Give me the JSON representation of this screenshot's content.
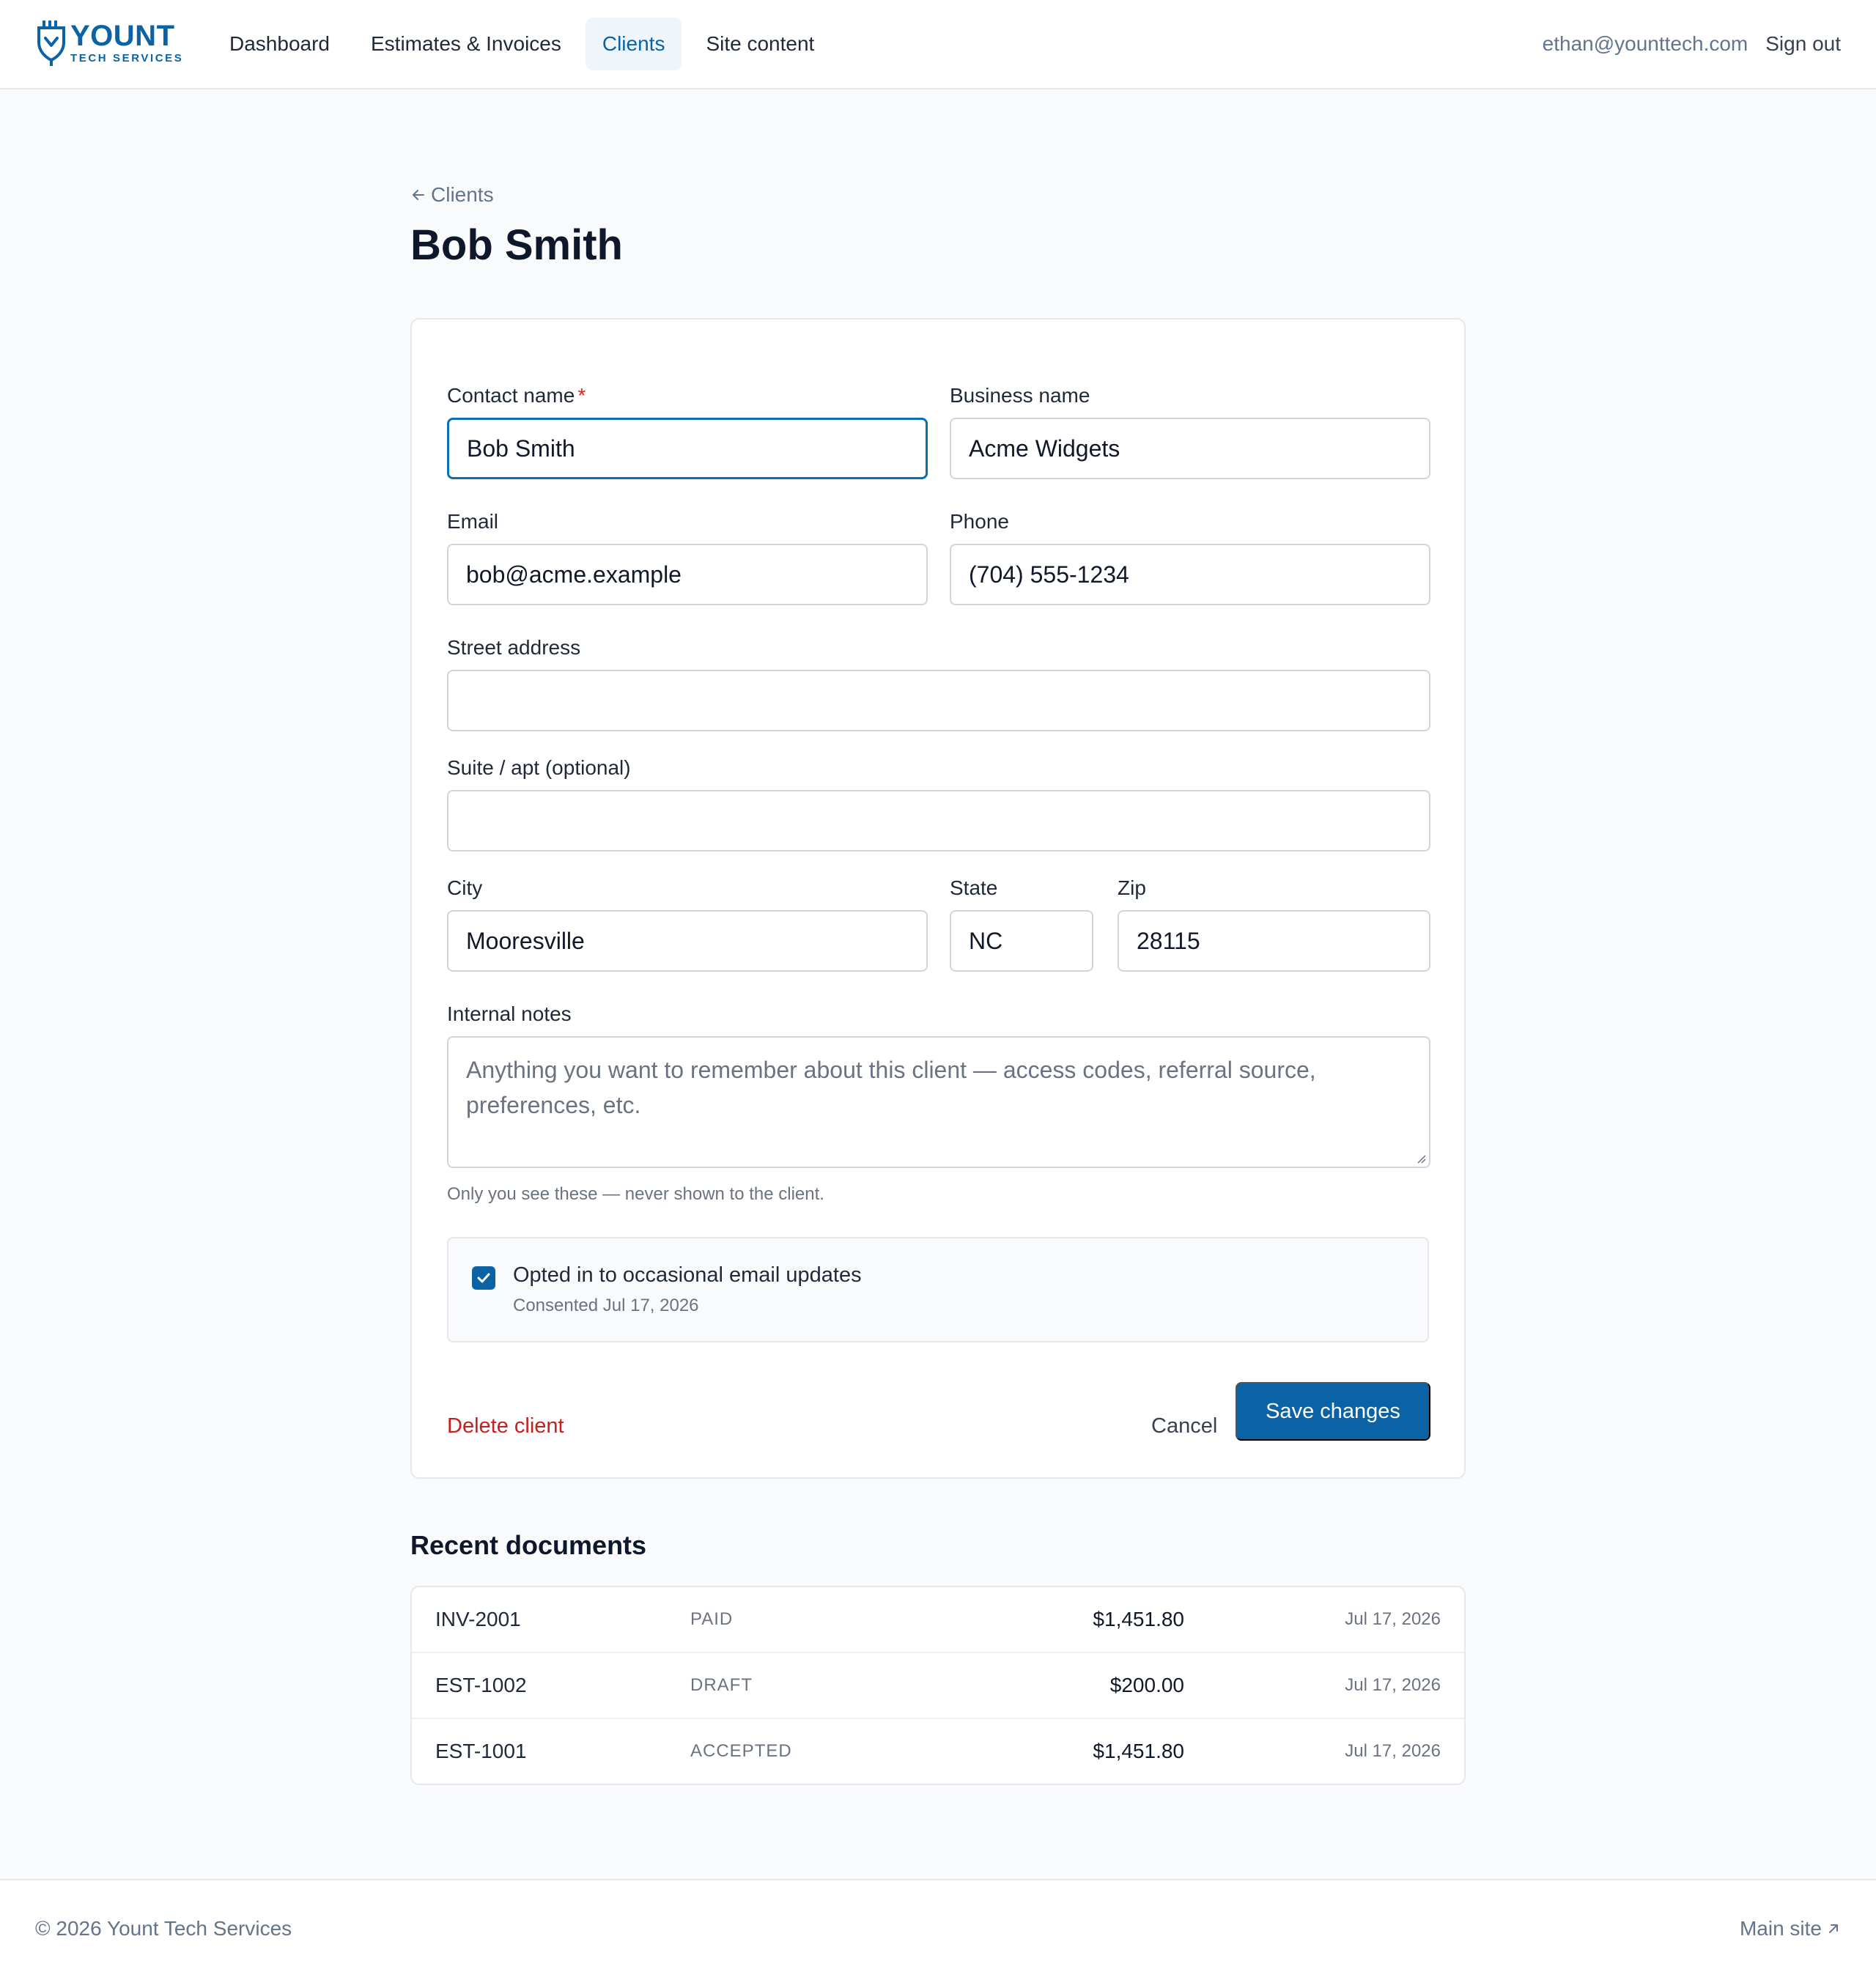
{
  "brand": {
    "name": "YOUNT",
    "tagline": "TECH SERVICES",
    "color": "#0b63a6"
  },
  "nav": {
    "items": [
      {
        "label": "Dashboard",
        "active": false
      },
      {
        "label": "Estimates & Invoices",
        "active": false
      },
      {
        "label": "Clients",
        "active": true
      },
      {
        "label": "Site content",
        "active": false
      }
    ]
  },
  "user": {
    "email": "ethan@younttech.com",
    "sign_out": "Sign out"
  },
  "breadcrumb": {
    "back_label": "Clients"
  },
  "page": {
    "title": "Bob Smith"
  },
  "form": {
    "contact_name": {
      "label": "Contact name",
      "required_mark": "*",
      "value": "Bob Smith"
    },
    "business_name": {
      "label": "Business name",
      "value": "Acme Widgets"
    },
    "email": {
      "label": "Email",
      "value": "bob@acme.example"
    },
    "phone": {
      "label": "Phone",
      "value": "(704) 555-1234"
    },
    "street": {
      "label": "Street address",
      "value": ""
    },
    "suite": {
      "label": "Suite / apt (optional)",
      "value": ""
    },
    "city": {
      "label": "City",
      "value": "Mooresville"
    },
    "state": {
      "label": "State",
      "value": "NC"
    },
    "zip": {
      "label": "Zip",
      "value": "28115"
    },
    "notes": {
      "label": "Internal notes",
      "placeholder": "Anything you want to remember about this client — access codes, referral source, preferences, etc.",
      "help": "Only you see these — never shown to the client."
    },
    "consent": {
      "checked": true,
      "label": "Opted in to occasional email updates",
      "sub": "Consented Jul 17, 2026"
    },
    "actions": {
      "delete": "Delete client",
      "cancel": "Cancel",
      "save": "Save changes"
    }
  },
  "documents": {
    "title": "Recent documents",
    "rows": [
      {
        "id": "INV-2001",
        "status": "PAID",
        "amount": "$1,451.80",
        "date": "Jul 17, 2026"
      },
      {
        "id": "EST-1002",
        "status": "DRAFT",
        "amount": "$200.00",
        "date": "Jul 17, 2026"
      },
      {
        "id": "EST-1001",
        "status": "ACCEPTED",
        "amount": "$1,451.80",
        "date": "Jul 17, 2026"
      }
    ]
  },
  "footer": {
    "copyright": "© 2026 Yount Tech Services",
    "main_site": "Main site"
  },
  "colors": {
    "primary": "#0b63a6",
    "danger": "#c81e1e",
    "active_nav_bg": "#eef6fc"
  }
}
